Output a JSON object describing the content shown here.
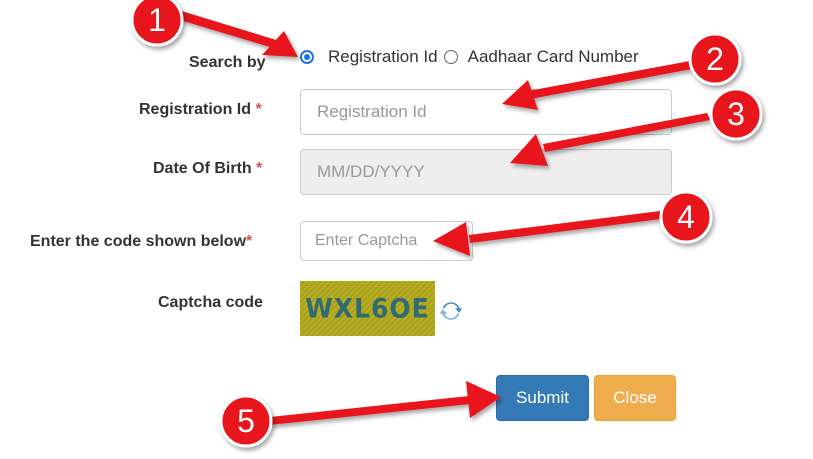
{
  "search_by": {
    "label": "Search by",
    "options": [
      {
        "label": "Registration Id",
        "selected": true
      },
      {
        "label": "Aadhaar Card Number",
        "selected": false
      }
    ]
  },
  "registration_id": {
    "label": "Registration Id",
    "required_mark": "*",
    "placeholder": "Registration Id"
  },
  "date_of_birth": {
    "label": "Date Of Birth",
    "required_mark": "*",
    "placeholder": "MM/DD/YYYY"
  },
  "captcha_entry": {
    "label": "Enter the code shown below",
    "required_mark": "*",
    "placeholder": "Enter Captcha"
  },
  "captcha": {
    "label": "Captcha code",
    "code": "WXL6OE",
    "refresh_icon": "refresh-icon"
  },
  "buttons": {
    "submit": "Submit",
    "close": "Close"
  },
  "annotations": [
    "1",
    "2",
    "3",
    "4",
    "5"
  ],
  "colors": {
    "annotation": "#e8121c",
    "submit": "#337ab7",
    "close": "#f0ad4e",
    "required": "#d9534f",
    "radio": "#1a73e8"
  }
}
